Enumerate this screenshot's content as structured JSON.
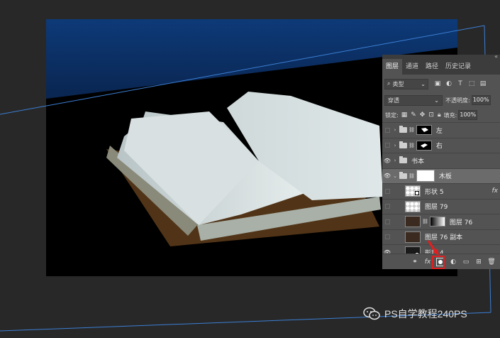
{
  "panel": {
    "tabs": [
      "图层",
      "通道",
      "路径",
      "历史记录"
    ],
    "filter": {
      "label": "类型",
      "icon": "search-icon"
    },
    "blend_mode": "穿透",
    "opacity": {
      "label": "不透明度:",
      "value": "100%"
    },
    "lock": {
      "label": "锁定:"
    },
    "fill": {
      "label": "填充:",
      "value": "100%"
    },
    "layers": [
      {
        "name": "左",
        "type": "group",
        "visible": false
      },
      {
        "name": "右",
        "type": "group",
        "visible": false
      },
      {
        "name": "书本",
        "type": "group",
        "visible": true
      },
      {
        "name": "木板",
        "type": "group",
        "visible": true,
        "selected": true
      },
      {
        "name": "形状 5",
        "type": "shape",
        "visible": false,
        "fx": "fx"
      },
      {
        "name": "图层 79",
        "type": "layer",
        "visible": false
      },
      {
        "name": "图层 76",
        "type": "layer",
        "visible": false
      },
      {
        "name": "图层 76 副本",
        "type": "layer",
        "visible": false
      },
      {
        "name": "形状 4",
        "type": "shape",
        "visible": true
      }
    ]
  },
  "watermark": "PS自学教程240PS",
  "colors": {
    "accent": "#e02020",
    "guide": "#3b7fd4",
    "panel": "#535353"
  }
}
